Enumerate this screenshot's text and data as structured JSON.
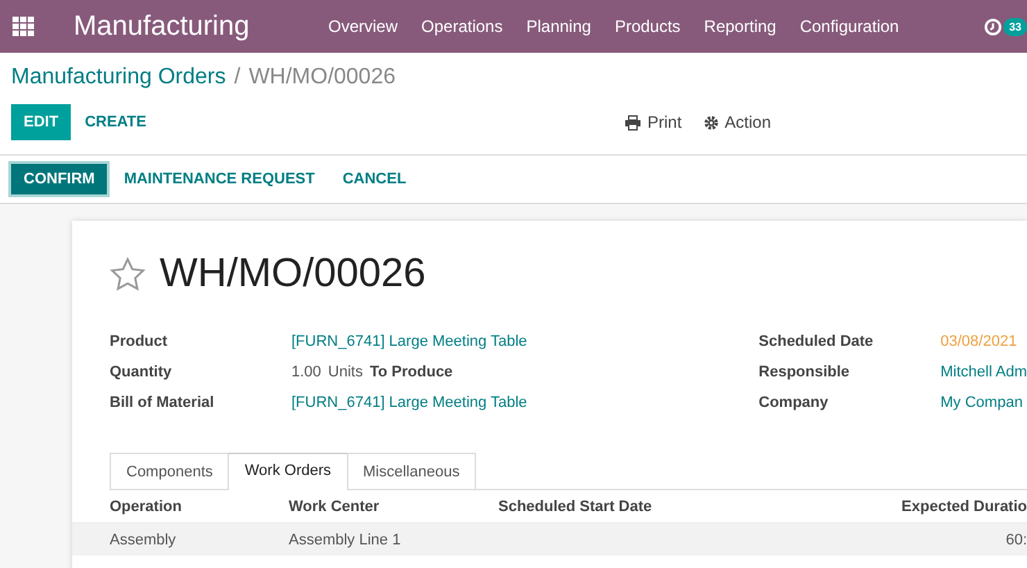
{
  "navbar": {
    "app_name": "Manufacturing",
    "menu": [
      "Overview",
      "Operations",
      "Planning",
      "Products",
      "Reporting",
      "Configuration"
    ],
    "activity_badge": "33"
  },
  "breadcrumb": {
    "parent": "Manufacturing Orders",
    "separator": "/",
    "current": "WH/MO/00026"
  },
  "control_panel": {
    "primary": "EDIT",
    "secondary": "CREATE",
    "print": "Print",
    "action": "Action"
  },
  "statusbar_buttons": [
    {
      "label": "CONFIRM",
      "kind": "primary"
    },
    {
      "label": "MAINTENANCE REQUEST",
      "kind": "link"
    },
    {
      "label": "CANCEL",
      "kind": "link"
    }
  ],
  "record": {
    "title": "WH/MO/00026",
    "starred": false
  },
  "fields_left": [
    {
      "label": "Product",
      "kind": "link",
      "value": "[FURN_6741] Large Meeting Table"
    },
    {
      "label": "Quantity",
      "kind": "quantity",
      "value": "1.00",
      "unit": "Units",
      "suffix": "To Produce"
    },
    {
      "label": "Bill of Material",
      "kind": "link",
      "value": "[FURN_6741] Large Meeting Table"
    }
  ],
  "fields_right": [
    {
      "label": "Scheduled Date",
      "kind": "date",
      "value": "03/08/2021"
    },
    {
      "label": "Responsible",
      "kind": "link",
      "value": "Mitchell Adm"
    },
    {
      "label": "Company",
      "kind": "link",
      "value": "My Compan"
    }
  ],
  "tabs": [
    {
      "label": "Components",
      "selected": false
    },
    {
      "label": "Work Orders",
      "selected": true
    },
    {
      "label": "Miscellaneous",
      "selected": false
    }
  ],
  "table": {
    "columns": [
      "Operation",
      "Work Center",
      "Scheduled Start Date",
      "Expected Duratio"
    ],
    "rows": [
      [
        "Assembly",
        "Assembly Line 1",
        "",
        "60:"
      ]
    ]
  }
}
